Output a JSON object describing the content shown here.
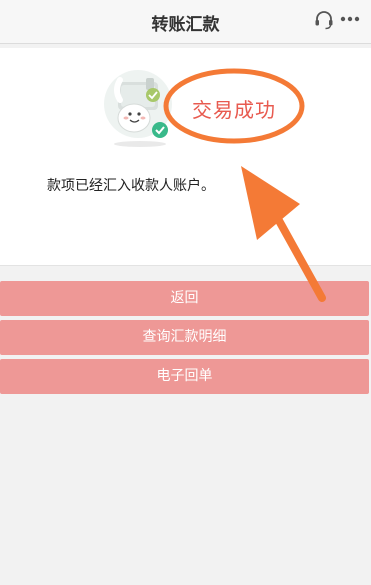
{
  "header": {
    "title": "转账汇款",
    "support_icon": "headset-icon",
    "more_icon": "more-dots-icon"
  },
  "result": {
    "status_text": "交易成功",
    "message": "款项已经汇入收款人账户。",
    "mascot_icon": "success-mascot-icon"
  },
  "actions": {
    "back_label": "返回",
    "query_label": "查询汇款明细",
    "receipt_label": "电子回单"
  },
  "colors": {
    "button_bg": "#ee9896",
    "status_text": "#e85a4f",
    "annotation": "#f47a36"
  }
}
